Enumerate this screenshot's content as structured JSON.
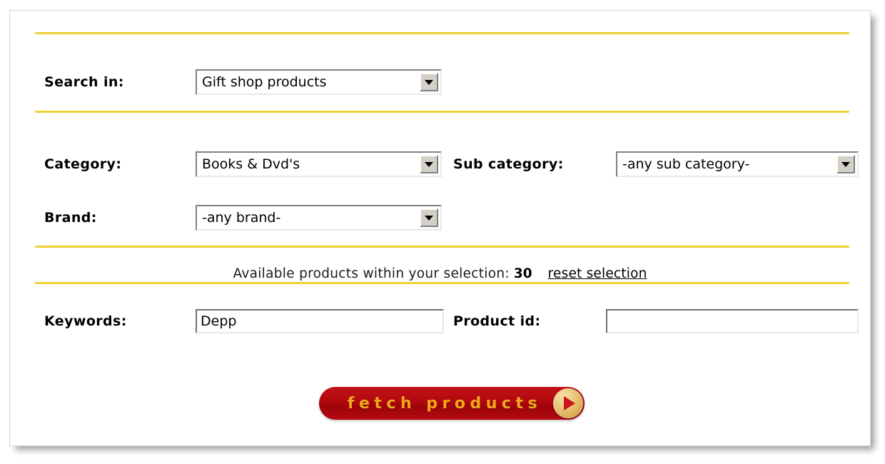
{
  "form": {
    "search_in": {
      "label": "Search in:",
      "selected": "Gift shop products"
    },
    "category": {
      "label": "Category:",
      "selected": "Books & Dvd's"
    },
    "sub_category": {
      "label": "Sub category:",
      "selected": "-any sub category-"
    },
    "brand": {
      "label": "Brand:",
      "selected": "-any brand-"
    },
    "availability": {
      "text": "Available products within your selection:",
      "count": "30",
      "reset_link": "reset selection"
    },
    "keywords": {
      "label": "Keywords:",
      "value": "Depp",
      "placeholder": ""
    },
    "product_id": {
      "label": "Product id:",
      "value": "",
      "placeholder": ""
    },
    "submit": {
      "label": "fetch products",
      "badge_icon": "play-triangle-icon"
    },
    "dropdown_icon": "chevron-down-icon"
  },
  "colors": {
    "rule": "#efd033",
    "button_red": "#b3080f",
    "button_text": "#f2a81c",
    "badge_gold": "#e8c375"
  }
}
